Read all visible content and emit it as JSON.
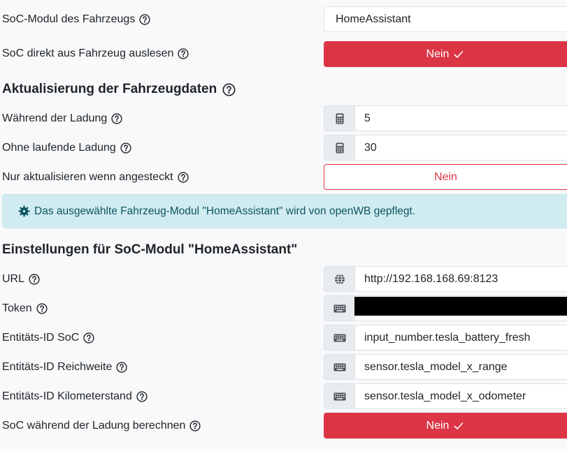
{
  "soc_module": {
    "label": "SoC-Modul des Fahrzeugs",
    "value": "HomeAssistant"
  },
  "soc_direct": {
    "label": "SoC direkt aus Fahrzeug auslesen",
    "button_label": "Nein"
  },
  "update_section": {
    "heading": "Aktualisierung der Fahrzeugdaten",
    "while_charging": {
      "label": "Während der Ladung",
      "value": "5"
    },
    "without_charging": {
      "label": "Ohne laufende Ladung",
      "value": "30"
    },
    "only_plugged": {
      "label": "Nur aktualisieren wenn angesteckt",
      "button_label": "Nein"
    }
  },
  "info_alert": {
    "text": "Das ausgewählte Fahrzeug-Modul \"HomeAssistant\" wird von openWB gepflegt."
  },
  "module_settings": {
    "heading": "Einstellungen für SoC-Modul \"HomeAssistant\"",
    "url": {
      "label": "URL",
      "value": "http://192.168.168.69:8123"
    },
    "token": {
      "label": "Token",
      "value": ""
    },
    "entity_soc": {
      "label": "Entitäts-ID SoC",
      "value": "input_number.tesla_battery_fresh"
    },
    "entity_range": {
      "label": "Entitäts-ID Reichweite",
      "value": "sensor.tesla_model_x_range"
    },
    "entity_odometer": {
      "label": "Entitäts-ID Kilometerstand",
      "value": "sensor.tesla_model_x_odometer"
    },
    "calc_soc": {
      "label": "SoC während der Ladung berechnen",
      "button_label": "Nein"
    }
  },
  "colors": {
    "danger": "#dc3545",
    "info_bg": "#d1ecf1",
    "info_text": "#0c5460",
    "addon_bg": "#e9ecef"
  },
  "icons": [
    "question-circle-icon",
    "check-icon",
    "calculator-icon",
    "globe-icon",
    "keyboard-icon",
    "gear-icon"
  ]
}
